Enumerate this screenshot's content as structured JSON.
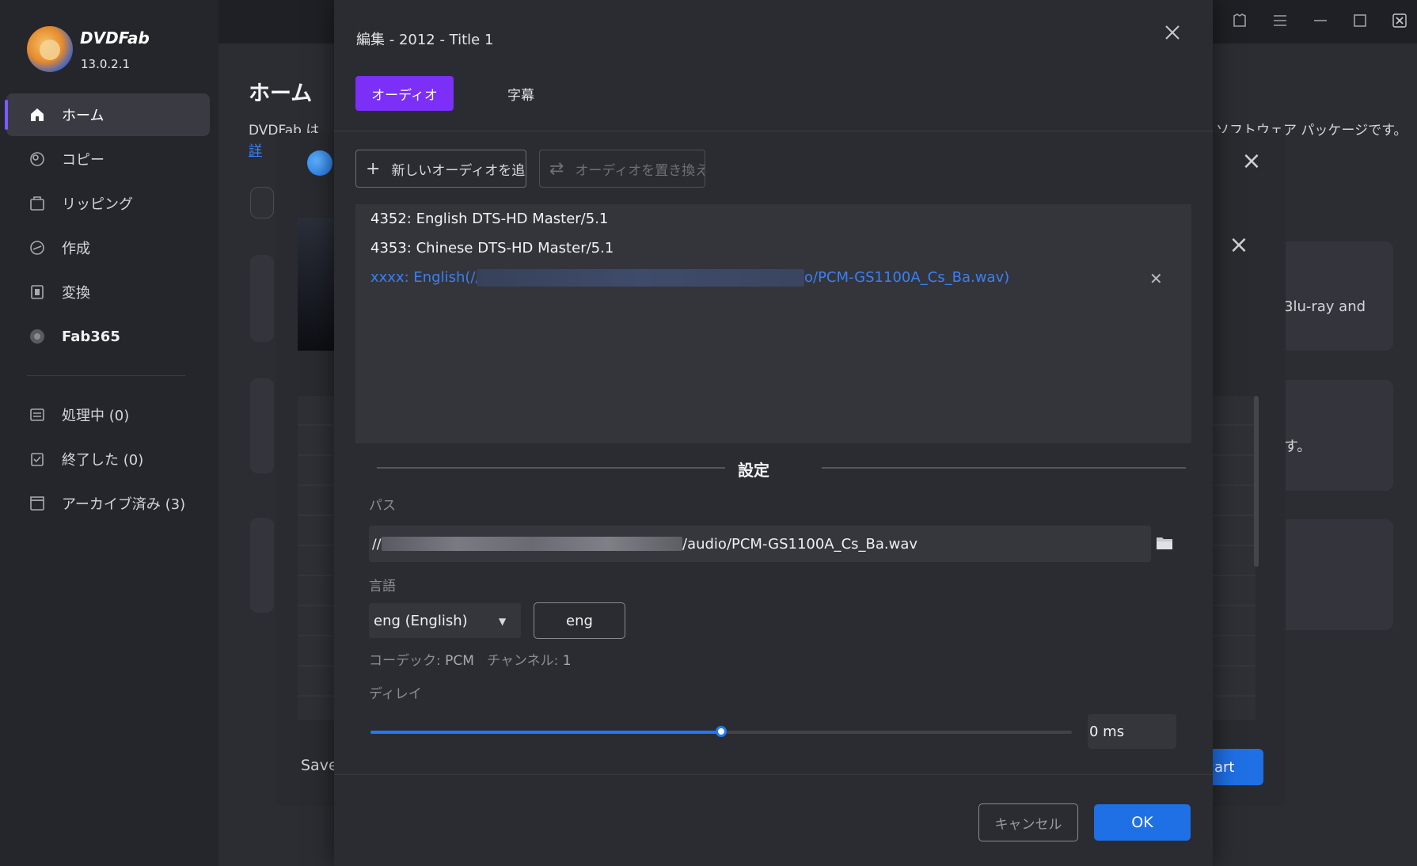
{
  "app": {
    "brand": "DVDFab",
    "version": "13.0.2.1"
  },
  "sidebar": {
    "items": [
      {
        "label": "ホーム",
        "icon": "home-icon"
      },
      {
        "label": "コピー",
        "icon": "copy-icon"
      },
      {
        "label": "リッピング",
        "icon": "ripper-icon"
      },
      {
        "label": "作成",
        "icon": "creator-icon"
      },
      {
        "label": "変換",
        "icon": "converter-icon"
      },
      {
        "label": "Fab365",
        "icon": "fab365-icon"
      }
    ],
    "queue": [
      {
        "label": "処理中 (0)",
        "icon": "processing-icon"
      },
      {
        "label": "終了した (0)",
        "icon": "finished-icon"
      },
      {
        "label": "アーカイブ済み (3)",
        "icon": "archived-icon"
      }
    ]
  },
  "home": {
    "title": "ホーム",
    "desc_start": "DVDFab は",
    "link": "詳",
    "desc_end": "ソフトウェア パッケージです。",
    "card_text_1": "3lu-ray and",
    "card_text_2": "す。"
  },
  "background_dialog": {
    "save_label": "Save",
    "start_label": "art"
  },
  "dialog": {
    "title": "編集 - 2012 - Title 1",
    "tabs": [
      "オーディオ",
      "字幕"
    ],
    "add_audio_label": "新しいオーディオを追加",
    "replace_audio_label": "オーディオを置き換え",
    "tracks": [
      "4352: English DTS-HD Master/5.1",
      "4353: Chinese DTS-HD Master/5.1"
    ],
    "selected_track_prefix": "xxxx: English(//",
    "selected_track_suffix": "o/PCM-GS1100A_Cs_Ba.wav)",
    "settings_title": "設定",
    "path_label": "パス",
    "path_prefix": "//",
    "path_suffix": "/audio/PCM-GS1100A_Cs_Ba.wav",
    "language_label": "言語",
    "language_value": "eng (English)",
    "language_code": "eng",
    "codec_label": "コーデック: ",
    "codec_value": "PCM",
    "channel_label": "チャンネル: ",
    "channel_value": "1",
    "delay_label": "ディレイ",
    "delay_value": "0 ms",
    "delay_slider_fraction": 0.5,
    "cancel_label": "キャンセル",
    "ok_label": "OK",
    "colors": {
      "accent_tab": "#7b2ff7",
      "primary": "#1f6fe5",
      "selected_track": "#3b7ff5"
    }
  }
}
